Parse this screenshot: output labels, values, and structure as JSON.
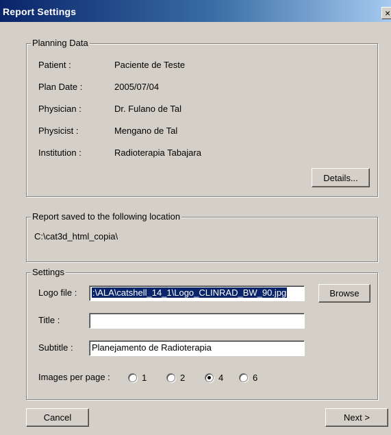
{
  "window": {
    "title": "Report Settings",
    "close_glyph": "×"
  },
  "planning": {
    "legend": "Planning Data",
    "rows": [
      {
        "label": "Patient :",
        "value": "Paciente de Teste"
      },
      {
        "label": "Plan Date :",
        "value": "2005/07/04"
      },
      {
        "label": "Physician :",
        "value": "Dr. Fulano de Tal"
      },
      {
        "label": "Physicist :",
        "value": "Mengano de Tal"
      },
      {
        "label": "Institution :",
        "value": "Radioterapia Tabajara"
      }
    ],
    "details_button": "Details..."
  },
  "location": {
    "legend": "Report saved to the following location",
    "path": "C:\\cat3d_html_copia\\"
  },
  "settings": {
    "legend": "Settings",
    "logo_label": "Logo file :",
    "logo_value": ":\\ALA\\catshell_14_1\\Logo_CLINRAD_BW_90.jpg",
    "browse_button": "Browse",
    "title_label": "Title :",
    "title_value": "",
    "subtitle_label": "Subtitle :",
    "subtitle_value": "Planejamento de Radioterapia",
    "images_label": "Images per page :",
    "images_options": [
      "1",
      "2",
      "4",
      "6"
    ],
    "images_selected": "4"
  },
  "footer": {
    "cancel_button": "Cancel",
    "next_button": "Next >"
  },
  "colors": {
    "titlebar_start": "#0a246a",
    "titlebar_end": "#a6caf0",
    "dialog_face": "#d4d0c8",
    "selection": "#0a246a"
  }
}
